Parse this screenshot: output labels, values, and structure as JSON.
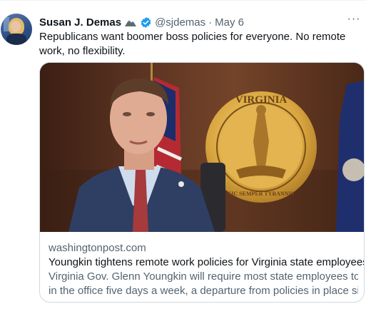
{
  "tweet": {
    "author_name": "Susan J. Demas",
    "author_emoji": "mountain-emoji",
    "verified_badge": "verified-icon",
    "handle": "@sjdemas",
    "separator": "·",
    "date": "May 6",
    "more_label": "···",
    "text": "Republicans want boomer boss policies for everyone. No remote work, no flexibility."
  },
  "card": {
    "domain": "washingtonpost.com",
    "title": "Youngkin tightens remote work policies for Virginia state employees",
    "description_line1": "Virginia Gov. Glenn Youngkin will require most state employees to work",
    "description_line2": "in the office five days a week, a departure from policies in place since ...",
    "seal_text_top": "VIRGINIA",
    "seal_text_bottom": "SIC SEMPER TYRANNIS"
  },
  "colors": {
    "accent": "#1d9bf0",
    "text_primary": "#0f1419",
    "text_secondary": "#536471",
    "border": "#cfd9de"
  }
}
